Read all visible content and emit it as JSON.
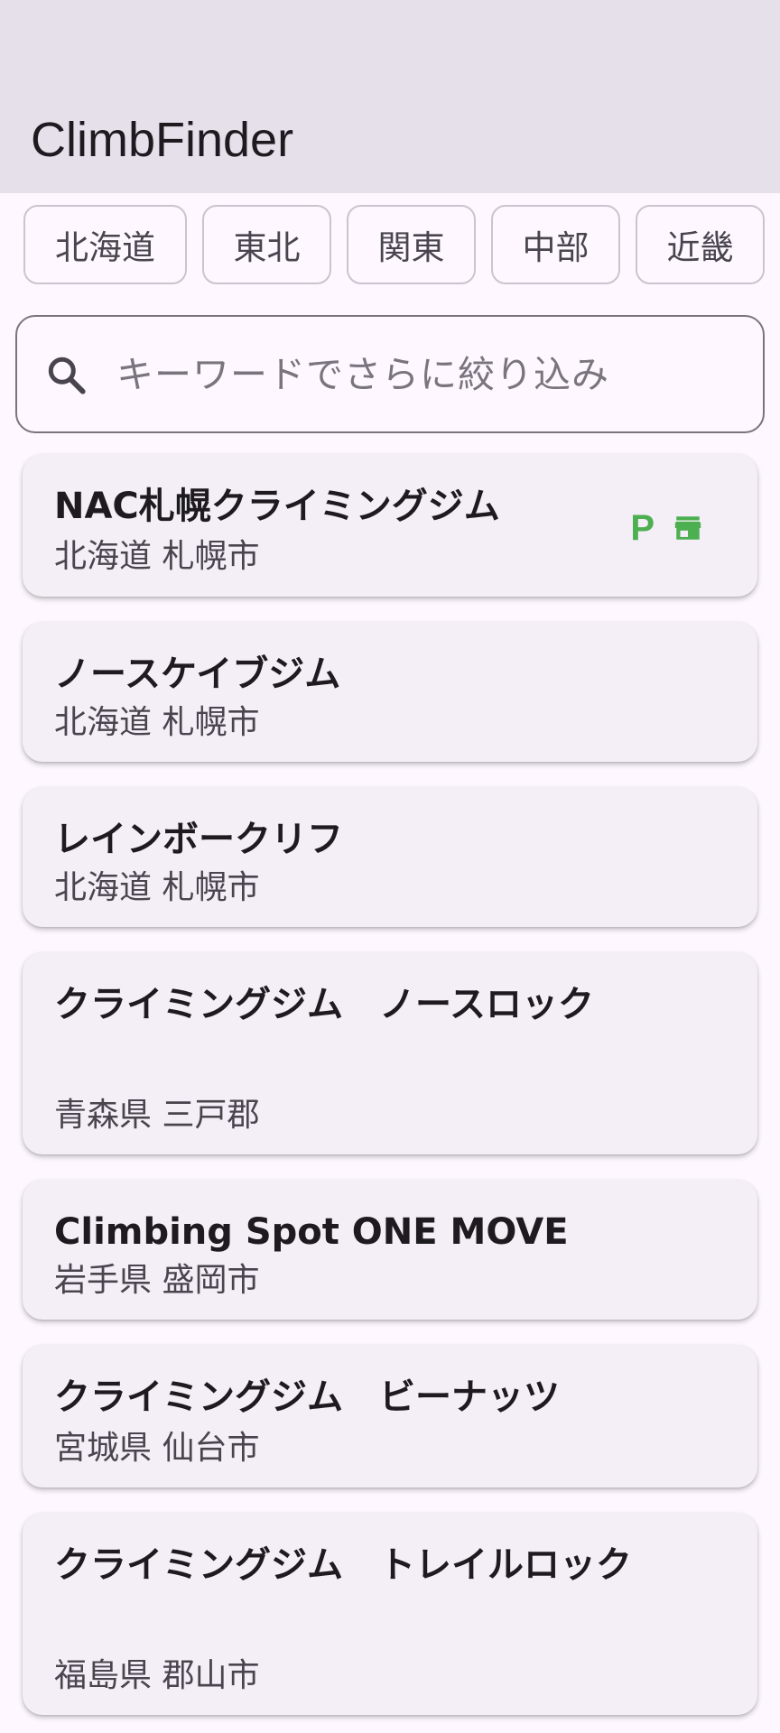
{
  "app": {
    "title": "ClimbFinder"
  },
  "filters": {
    "regions": [
      "北海道",
      "東北",
      "関東",
      "中部",
      "近畿"
    ]
  },
  "search": {
    "placeholder": "キーワードでさらに絞り込み",
    "icon": "search-icon"
  },
  "accent_colors": {
    "facility_icon": "#4caf50",
    "appbar": "#e6e0ea",
    "card": "#f4eef6"
  },
  "gyms": [
    {
      "name": "NAC札幌クライミングジム",
      "location": "北海道 札幌市",
      "facilities": [
        "parking-icon",
        "store-icon"
      ]
    },
    {
      "name": "ノースケイブジム",
      "location": "北海道 札幌市",
      "facilities": []
    },
    {
      "name": "レインボークリフ",
      "location": "北海道 札幌市",
      "facilities": []
    },
    {
      "name": "クライミングジム　ノースロック",
      "location": "青森県 三戸郡",
      "facilities": []
    },
    {
      "name": "Climbing Spot ONE MOVE",
      "location": "岩手県 盛岡市",
      "facilities": []
    },
    {
      "name": "クライミングジム　ビーナッツ",
      "location": "宮城県 仙台市",
      "facilities": []
    },
    {
      "name": "クライミングジム　トレイルロック",
      "location": "福島県 郡山市",
      "facilities": []
    }
  ]
}
